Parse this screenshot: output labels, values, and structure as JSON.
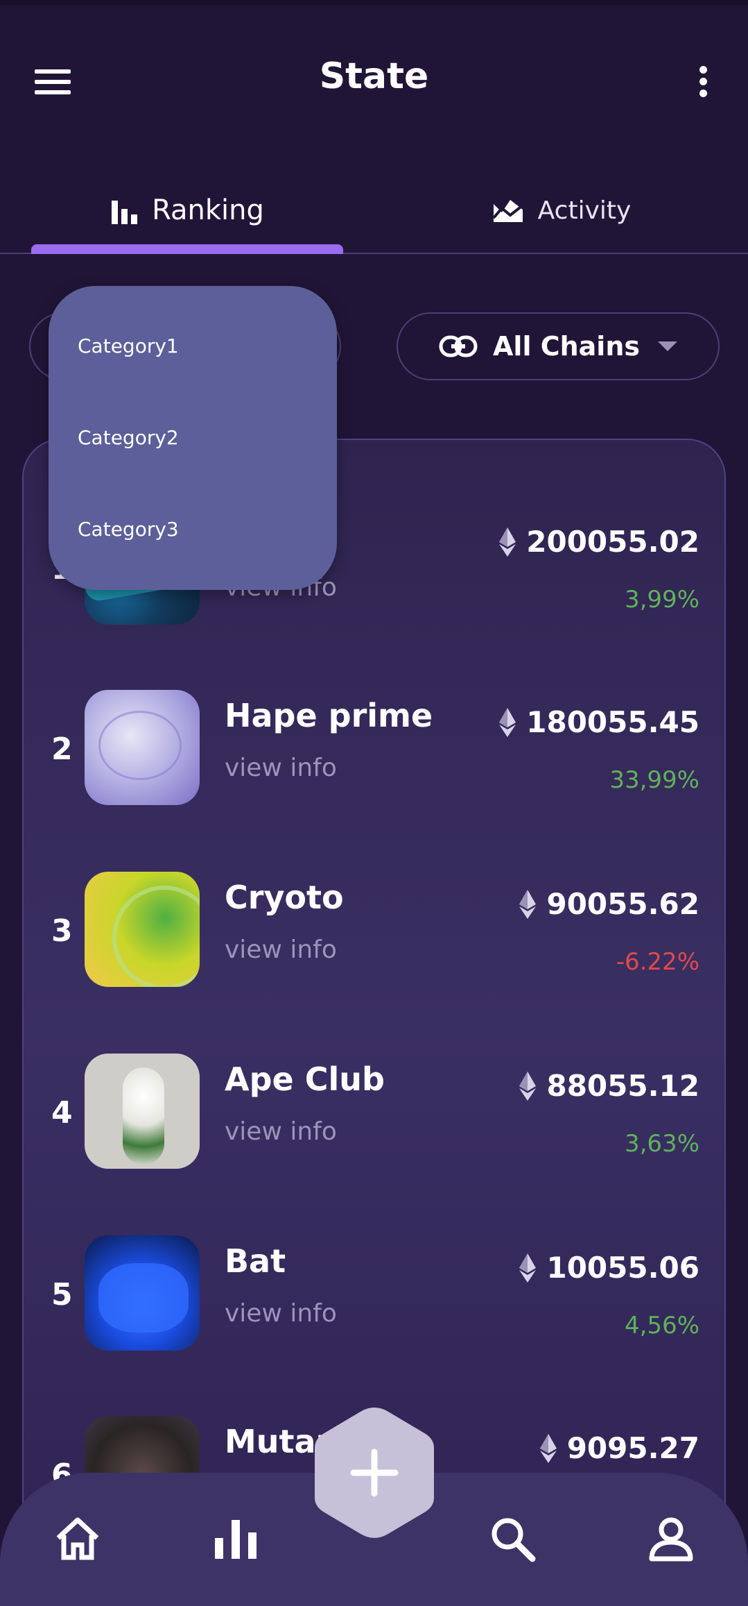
{
  "header": {
    "title": "State"
  },
  "tabs": [
    {
      "label": "Ranking",
      "icon": "bar-chart-icon",
      "active": true
    },
    {
      "label": "Activity",
      "icon": "area-chart-icon",
      "active": false
    }
  ],
  "filters": {
    "chains_label": "All Chains",
    "chains_icon": "link-icon"
  },
  "dropdown": {
    "items": [
      "Category1",
      "Category2",
      "Category3"
    ]
  },
  "rankings": [
    {
      "rank": "1",
      "name": "",
      "info": "view info",
      "price": "200055.02",
      "change": "3,99%",
      "trend": "up"
    },
    {
      "rank": "2",
      "name": "Hape prime",
      "info": "view info",
      "price": "180055.45",
      "change": "33,99%",
      "trend": "up"
    },
    {
      "rank": "3",
      "name": "Cryoto",
      "info": "view info",
      "price": "90055.62",
      "change": "-6.22%",
      "trend": "down"
    },
    {
      "rank": "4",
      "name": "Ape Club",
      "info": "view info",
      "price": "88055.12",
      "change": "3,63%",
      "trend": "up"
    },
    {
      "rank": "5",
      "name": "Bat",
      "info": "view info",
      "price": "10055.06",
      "change": "4,56%",
      "trend": "up"
    },
    {
      "rank": "6",
      "name": "Mutant",
      "info": "",
      "price": "9095.27",
      "change": "",
      "trend": "up"
    }
  ],
  "colors": {
    "accent": "#9a6cf0",
    "positive": "#5fb25a",
    "negative": "#e04a4a",
    "background": "#211537",
    "dropdown": "#5c5f99"
  },
  "nav": [
    "home-icon",
    "stats-icon",
    "add-icon",
    "search-icon",
    "profile-icon"
  ]
}
